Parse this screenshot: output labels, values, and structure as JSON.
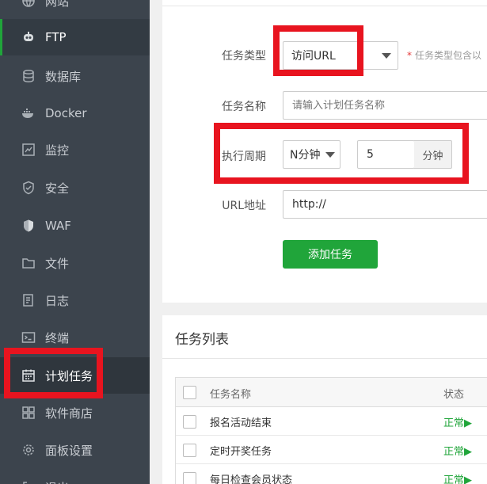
{
  "sidebar": {
    "items": [
      {
        "label": "网站",
        "icon": "globe-icon"
      },
      {
        "label": "FTP",
        "icon": "ftp-icon"
      },
      {
        "label": "数据库",
        "icon": "database-icon"
      },
      {
        "label": "Docker",
        "icon": "docker-icon"
      },
      {
        "label": "监控",
        "icon": "monitor-icon"
      },
      {
        "label": "安全",
        "icon": "shield-icon"
      },
      {
        "label": "WAF",
        "icon": "waf-shield-icon"
      },
      {
        "label": "文件",
        "icon": "folder-icon"
      },
      {
        "label": "日志",
        "icon": "log-icon"
      },
      {
        "label": "终端",
        "icon": "terminal-icon"
      },
      {
        "label": "计划任务",
        "icon": "calendar-icon"
      },
      {
        "label": "软件商店",
        "icon": "apps-grid-icon"
      },
      {
        "label": "面板设置",
        "icon": "gear-icon"
      },
      {
        "label": "退出",
        "icon": "logout-icon"
      }
    ]
  },
  "form": {
    "task_type": {
      "label": "任务类型",
      "value": "访问URL",
      "hint": "任务类型包含以"
    },
    "task_name": {
      "label": "任务名称",
      "placeholder": "请输入计划任务名称"
    },
    "period": {
      "label": "执行周期",
      "mode": "N分钟",
      "value": "5",
      "unit": "分钟"
    },
    "url": {
      "label": "URL地址",
      "value": "http://"
    },
    "submit_label": "添加任务"
  },
  "task_list": {
    "title": "任务列表",
    "columns": {
      "name": "任务名称",
      "status": "状态"
    },
    "rows": [
      {
        "name": "报名活动结束",
        "status": "正常▶"
      },
      {
        "name": "定时开奖任务",
        "status": "正常▶"
      },
      {
        "name": "每日检查会员状态",
        "status": "正常▶"
      }
    ]
  },
  "colors": {
    "sidebar_bg": "#3c444d",
    "accent_green": "#20a53a",
    "highlight_red": "#e8141f"
  }
}
